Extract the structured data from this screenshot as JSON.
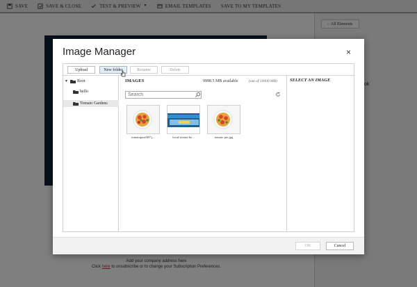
{
  "toolbar": {
    "save": "SAVE",
    "save_close": "SAVE & CLOSE",
    "test_preview": "TEST & PREVIEW",
    "email_templates": "EMAIL TEMPLATES",
    "save_to_my_templates": "SAVE TO MY TEMPLATES"
  },
  "right_panel": {
    "all_elements_label": "All Elements",
    "partial_text": "ok"
  },
  "email_footer": {
    "line1": "Add your company address here",
    "line2_before": "Click ",
    "line2_link": "here",
    "line2_after": " to unsubscribe or to change your Subscription Preferences."
  },
  "modal": {
    "title": "Image Manager",
    "close_glyph": "×",
    "toolbar": {
      "upload": "Upload",
      "new_folder": "New folder",
      "rename": "Rename",
      "delete": "Delete"
    },
    "tree": {
      "root": "Root",
      "children": [
        "hello",
        "Tomato Gardens"
      ]
    },
    "images_heading": "IMAGES",
    "available": "9998.5 MB available",
    "capacity": "(out of 10000 MB)",
    "search_placeholder": "Search",
    "images": [
      {
        "name": "tomatopastiM7.j..."
      },
      {
        "name": "local-events-he..."
      },
      {
        "name": "tomato pie.jpg"
      }
    ],
    "select_heading": "SELECT AN IMAGE",
    "ok": "OK",
    "cancel": "Cancel"
  },
  "colors": {
    "overlay": "#000000",
    "email_dark": "#0e2236",
    "banner_blue": "#2f8fd0",
    "banner_yellow": "#f1d44a",
    "tomato_red": "#d9432f",
    "link_red": "#c0392b"
  }
}
